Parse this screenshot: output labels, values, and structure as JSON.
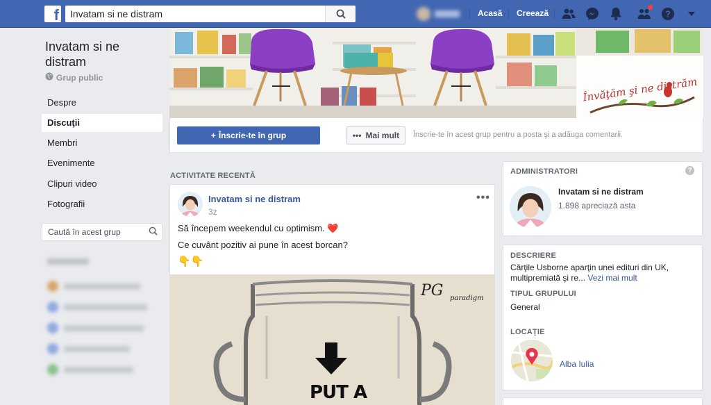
{
  "topbar": {
    "search_value": "Invatam si ne distram",
    "home": "Acasă",
    "create": "Creează"
  },
  "group": {
    "name": "Invatam si ne distram",
    "privacy": "Grup public",
    "nav": [
      "Despre",
      "Discuţii",
      "Membri",
      "Evenimente",
      "Clipuri video",
      "Fotografii"
    ],
    "search_placeholder": "Caută în acest grup",
    "join_label": "Înscrie-te în grup",
    "more_label": "Mai mult",
    "join_hint": "Înscrie-te în acest grup pentru a posta şi a adăuga comentarii.",
    "cover_logo_text": "Învăţăm şi ne distrăm"
  },
  "feed": {
    "section_title": "ACTIVITATE RECENTĂ",
    "post": {
      "author": "Invatam si ne distram",
      "time": "3z",
      "line1": "Să începem weekendul cu optimism. ❤️",
      "line2": "Ce cuvânt pozitiv ai pune în acest borcan?",
      "line3": "👇👇",
      "image_logo": "PG",
      "image_logo_sub": "paradigm",
      "image_text": "PUT A"
    }
  },
  "sidebar": {
    "admins_title": "ADMINISTRATORI",
    "admin_name": "Invatam si ne distram",
    "admin_likes": "1.898 apreciază asta",
    "desc_title": "DESCRIERE",
    "desc_text": "Cărţile Usborne aparţin unei edituri din UK, multipremiată şi re...",
    "see_more": "Vezi mai mult",
    "type_title": "TIPUL GRUPULUI",
    "type_value": "General",
    "location_title": "LOCAŢIE",
    "location": "Alba Iulia"
  },
  "colors": {
    "brand": "#4267b2",
    "link": "#385898",
    "background": "#e9ebee"
  }
}
